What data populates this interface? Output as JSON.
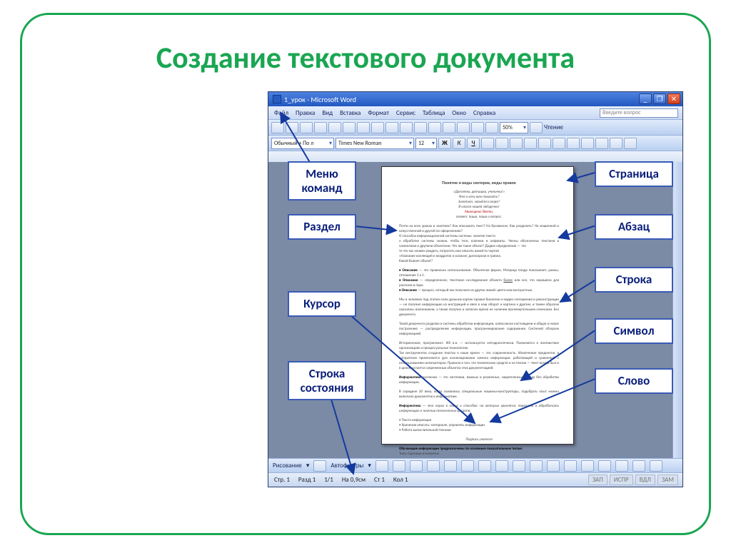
{
  "slide_title": "Создание текстового документа",
  "word": {
    "window_title": "1_урок - Microsoft Word",
    "menus": [
      "Файл",
      "Правка",
      "Вид",
      "Вставка",
      "Формат",
      "Сервис",
      "Таблица",
      "Окно",
      "Справка"
    ],
    "question_placeholder": "Введите вопрос",
    "style_selector": "Обычный + По л",
    "font_selector": "Times New Roman",
    "size_selector": "12",
    "zoom": "50%",
    "read_mode": "Чтение",
    "draw_label": "Рисование",
    "autoshapes": "Автофигуры",
    "status": {
      "page": "Стр. 1",
      "section": "Разд 1",
      "pages": "1/1",
      "at": "На 0,9см",
      "line": "Ст 1",
      "col": "Кол 1",
      "flags": [
        "ЗАП",
        "ИСПР",
        "ВДЛ",
        "ЗАМ"
      ]
    }
  },
  "callouts": {
    "menu": "Меню команд",
    "section": "Раздел",
    "cursor": "Курсор",
    "statusbar": "Строка состояния",
    "page": "Страница",
    "paragraph": "Абзац",
    "line_text": "Строка",
    "symbol": "Символ",
    "word_unit": "Слово"
  },
  "arrow_color": "#143a9e"
}
